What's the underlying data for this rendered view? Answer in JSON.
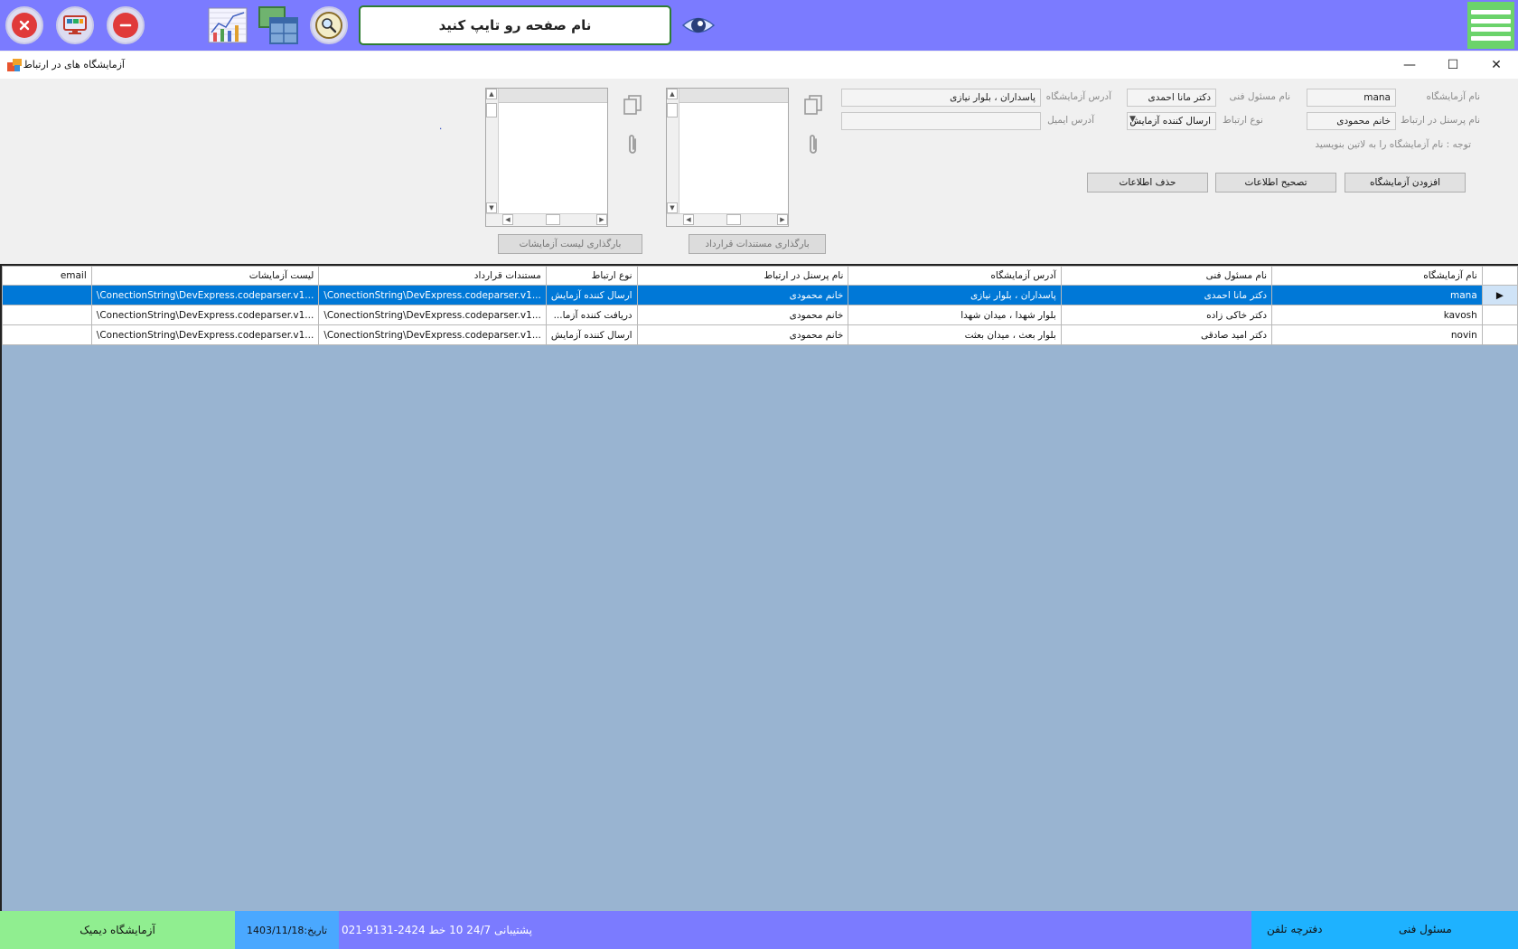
{
  "topbar": {
    "page_search_label": "نام صفحه رو تایپ کنید",
    "buttons": [
      "close-app",
      "monitor",
      "minimize",
      "chart",
      "windows",
      "search-zoom",
      "eye"
    ]
  },
  "window": {
    "title": "آزمایشگاه های در ارتباط",
    "min_glyph": "—",
    "max_glyph": "☐",
    "close_glyph": "✕"
  },
  "form": {
    "lab_name_label": "نام آزمایشگاه",
    "lab_name_value": "mana",
    "tech_manager_label": "نام مسئول فنی",
    "tech_manager_value": "دکتر مانا احمدی",
    "lab_address_label": "آدرس آزمایشگاه",
    "lab_address_value": "پاسداران ، بلوار نیازی",
    "contact_person_label": "نام پرسنل در ارتباط",
    "contact_person_value": "خانم محمودی",
    "relation_type_label": "نوع ارتباط",
    "relation_type_value": "ارسال کننده آزمایش",
    "email_label": "آدرس ایمیل",
    "email_value": "",
    "note": "توجه : نام آزمایشگاه را به لاتین بنویسید",
    "add_button": "افزودن آزمایشگاه",
    "edit_button": "تصحیح اطلاعات",
    "delete_button": "حذف اطلاعات",
    "upload_contracts_button": "بارگذاری مستندات قرارداد",
    "upload_tests_button": "بارگذاری لیست آزمایشات",
    "dot": "."
  },
  "grid": {
    "columns": [
      "نام آزمایشگاه",
      "نام مسئول فنی",
      "آدرس آزمایشگاه",
      "نام پرسنل در ارتباط",
      "نوع ارتباط",
      "مستندات قرارداد",
      "لیست آزمایشات",
      "email"
    ],
    "row_indicator": "▶",
    "rows": [
      {
        "name": "mana",
        "manager": "دکتر مانا احمدی",
        "address": "پاسداران ، بلوار نیازی",
        "contact": "خانم محمودی",
        "type": "ارسال کننده آزمایش",
        "contracts": "\\ConectionString\\DevExpress.codeparser.v1...",
        "tests": "\\ConectionString\\DevExpress.codeparser.v1...",
        "email": ""
      },
      {
        "name": "kavosh",
        "manager": "دکتر خاکی زاده",
        "address": "بلوار شهدا ، میدان شهدا",
        "contact": "خانم محمودی",
        "type": "دریافت کننده آزما...",
        "contracts": "\\ConectionString\\DevExpress.codeparser.v1...",
        "tests": "\\ConectionString\\DevExpress.codeparser.v1...",
        "email": ""
      },
      {
        "name": "novin",
        "manager": "دکتر امید صادقی",
        "address": "بلوار بعث ، میدان بعثت",
        "contact": "خانم محمودی",
        "type": "ارسال کننده آزمایش",
        "contracts": "\\ConectionString\\DevExpress.codeparser.v1...",
        "tests": "\\ConectionString\\DevExpress.codeparser.v1...",
        "email": ""
      }
    ]
  },
  "statusbar": {
    "lab_name": "آزمایشگاه دیمیک",
    "date": "تاریخ:1403/11/18",
    "support": "پشتیبانی 24/7   10 خط  2424-9131-021",
    "phonebook": "دفترچه تلفن",
    "tech_manager": "مسئول فنی"
  },
  "colors": {
    "topbar": "#7b7bff",
    "grid_bg": "#99b4d1",
    "selection": "#0078d7",
    "status_green": "#90ee90",
    "status_blue": "#1eb2ff"
  }
}
